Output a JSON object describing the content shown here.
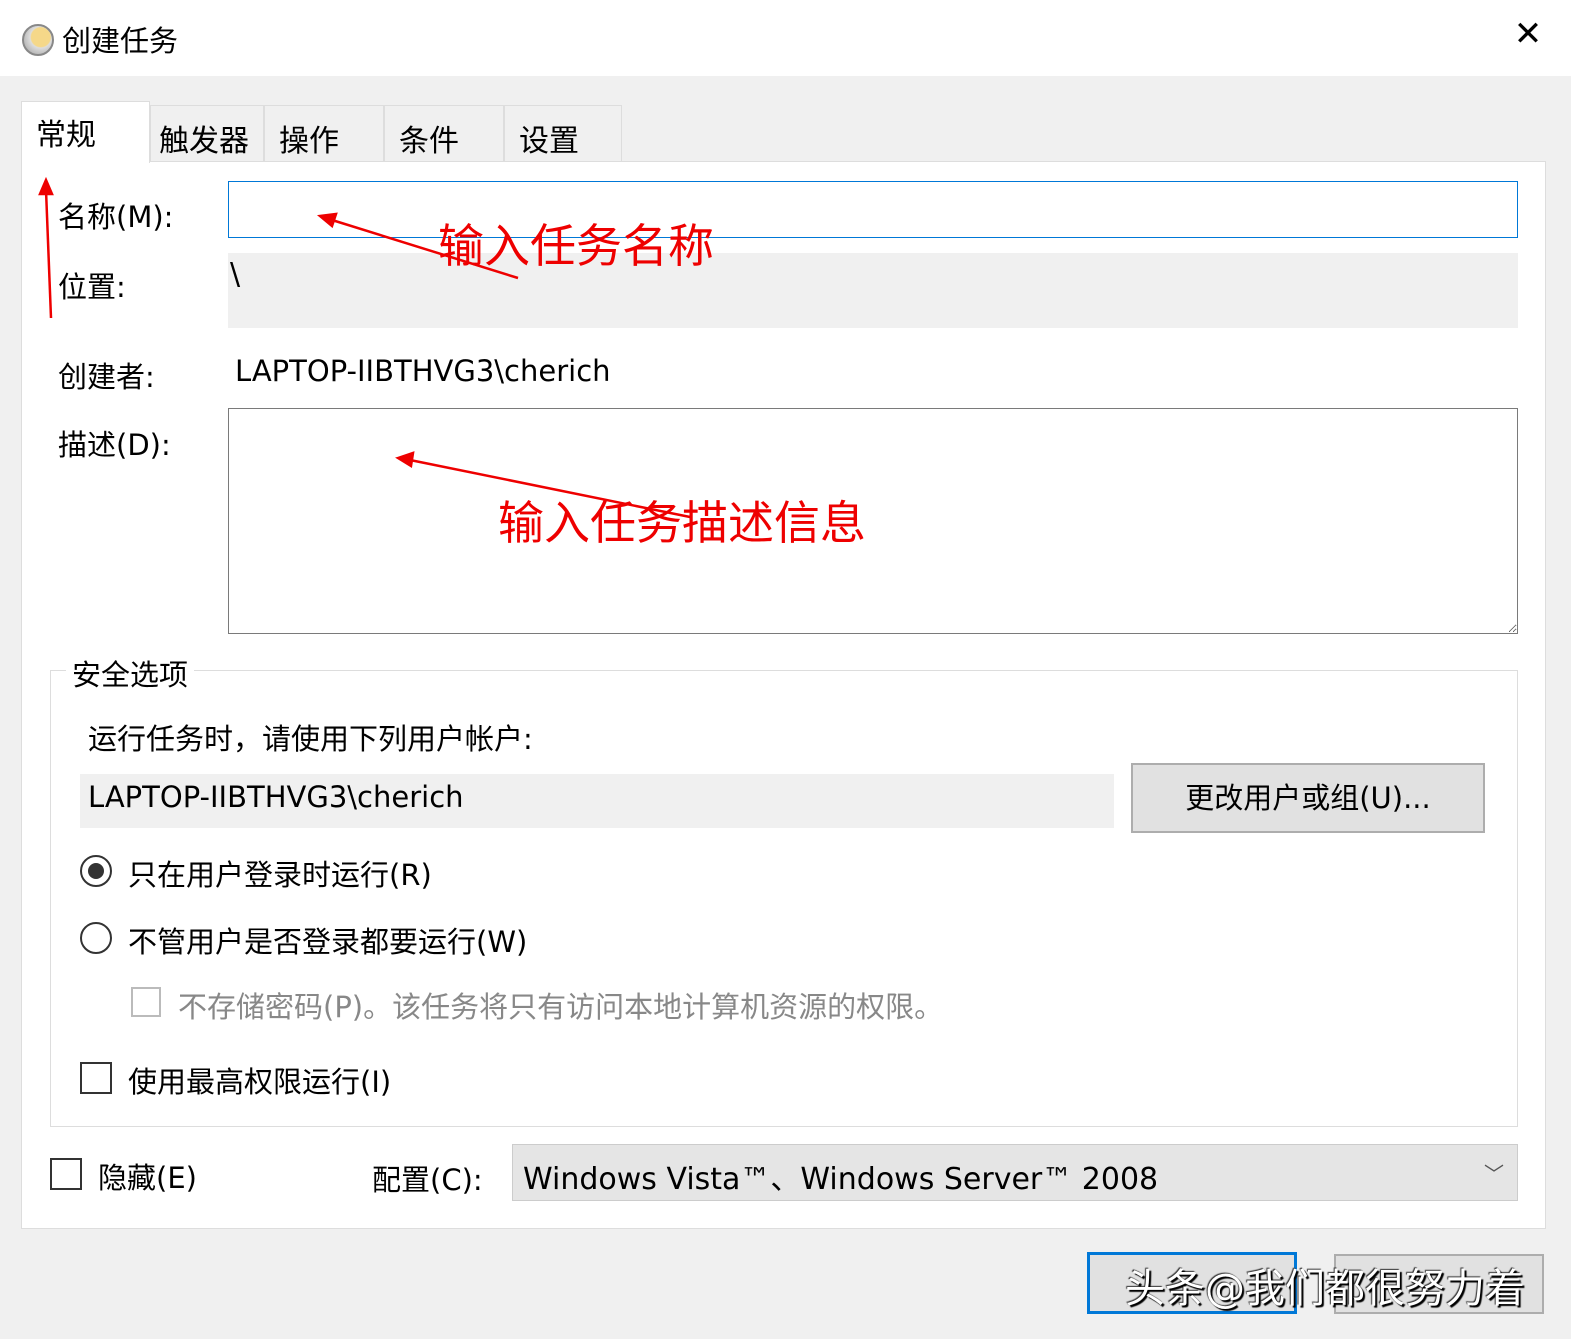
{
  "window": {
    "title": "创建任务",
    "close_icon": "close-icon"
  },
  "tabs": [
    {
      "label": "常规",
      "active": true
    },
    {
      "label": "触发器"
    },
    {
      "label": "操作"
    },
    {
      "label": "条件"
    },
    {
      "label": "设置"
    }
  ],
  "general": {
    "name_label": "名称(M):",
    "name_value": "",
    "location_label": "位置:",
    "location_value": "\\",
    "author_label": "创建者:",
    "author_value": "LAPTOP-IIBTHVG3\\cherich",
    "description_label": "描述(D):",
    "description_value": ""
  },
  "security": {
    "title": "安全选项",
    "run_as_label": "运行任务时，请使用下列用户帐户:",
    "account": "LAPTOP-IIBTHVG3\\cherich",
    "change_button": "更改用户或组(U)...",
    "radio_logged_on": "只在用户登录时运行(R)",
    "radio_always": "不管用户是否登录都要运行(W)",
    "no_store_password": "不存储密码(P)。该任务将只有访问本地计算机资源的权限。",
    "highest_privileges": "使用最高权限运行(I)",
    "selected_radio": "logged_on"
  },
  "footer": {
    "hidden_label": "隐藏(E)",
    "config_label": "配置(C):",
    "config_value": "Windows Vista™、Windows Server™ 2008"
  },
  "annotations": {
    "name_hint": "输入任务名称",
    "desc_hint": "输入任务描述信息",
    "color": "#e00000"
  },
  "watermark": "头条@我们都很努力着"
}
